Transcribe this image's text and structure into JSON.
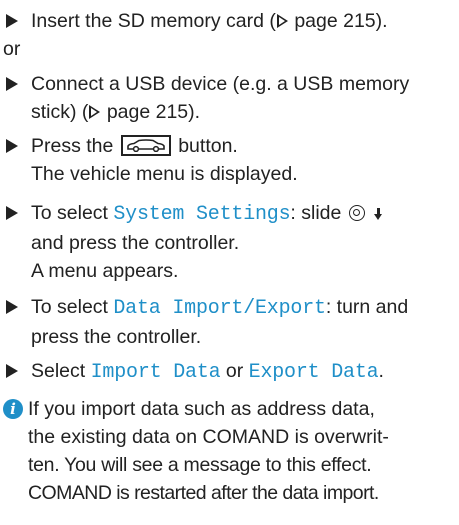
{
  "steps": {
    "s1": {
      "text": "Insert the SD memory card (",
      "page": " page 215)."
    },
    "or_label": "or",
    "s2": {
      "line1": "Connect a USB device (e.g. a USB memory",
      "line2_a": "stick) (",
      "line2_b": " page 215)."
    },
    "s3": {
      "a": "Press the ",
      "b": " button.",
      "line2": "The vehicle menu is displayed."
    },
    "s4": {
      "a": "To select ",
      "menu": "System Settings",
      "b": ": slide ",
      "line2": "and press the controller.",
      "line3": "A menu appears."
    },
    "s5": {
      "a": "To select ",
      "menu": "Data Import/Export",
      "b": ": turn and",
      "line2": "press the controller."
    },
    "s6": {
      "a": "Select ",
      "menu1": "Import Data",
      "mid": " or ",
      "menu2": "Export Data",
      "end": "."
    }
  },
  "info": {
    "icon": "i",
    "line1": "If you import data such as address data,",
    "line2": "the existing data on COMAND is overwrit-",
    "line3": "ten. You will see a message to this effect.",
    "line4": "COMAND is restarted after the data import."
  },
  "colors": {
    "text": "#222222",
    "accent": "#1f8fc8"
  }
}
